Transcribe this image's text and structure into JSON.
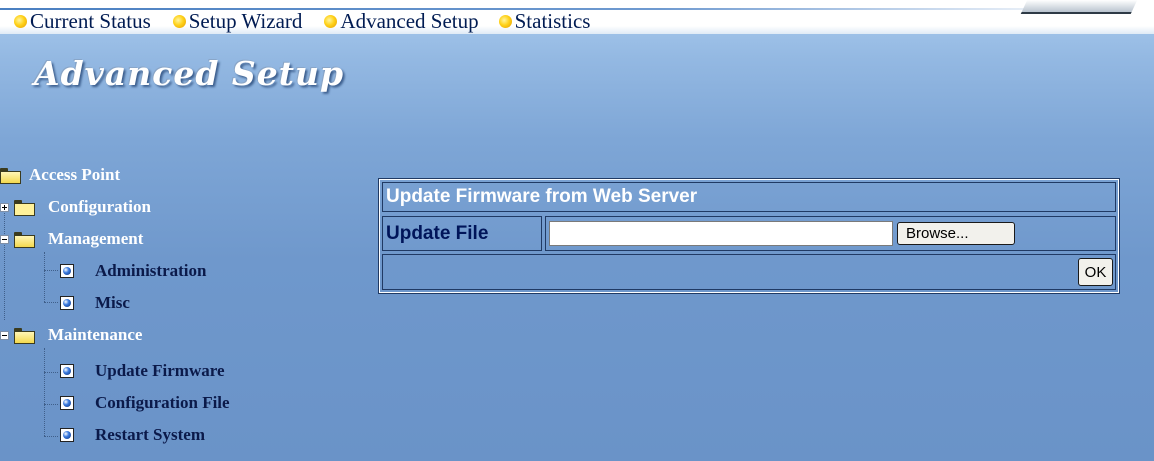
{
  "nav": {
    "items": [
      {
        "label": "Current Status",
        "icon": "orange-bullet-icon"
      },
      {
        "label": "Setup Wizard",
        "icon": "orange-bullet-icon"
      },
      {
        "label": "Advanced Setup",
        "icon": "orange-bullet-icon"
      },
      {
        "label": "Statistics",
        "icon": "orange-bullet-icon"
      }
    ]
  },
  "page_title": "Advanced Setup",
  "tree": {
    "root": {
      "label": "Access Point",
      "icon": "folder-open-icon"
    },
    "configuration": {
      "label": "Configuration",
      "expanded": false,
      "icon": "folder-closed-icon"
    },
    "management": {
      "label": "Management",
      "expanded": true,
      "icon": "folder-open-icon",
      "children": [
        {
          "label": "Administration",
          "icon": "page-icon"
        },
        {
          "label": "Misc",
          "icon": "page-icon"
        }
      ]
    },
    "maintenance": {
      "label": "Maintenance",
      "expanded": true,
      "icon": "folder-open-icon",
      "children": [
        {
          "label": "Update Firmware",
          "icon": "page-icon"
        },
        {
          "label": "Configuration File",
          "icon": "page-icon"
        },
        {
          "label": "Restart System",
          "icon": "page-icon"
        }
      ]
    }
  },
  "panel": {
    "heading": "Update Firmware from Web Server",
    "field_label": "Update File",
    "file_value": "",
    "browse_label": "Browse...",
    "ok_label": "OK"
  },
  "colors": {
    "nav_text": "#001b52",
    "tree_leaf_text": "#0b1a4a",
    "panel_label_text": "#00155a",
    "background_top": "#a9cbee",
    "background_bottom": "#6a93c8"
  }
}
